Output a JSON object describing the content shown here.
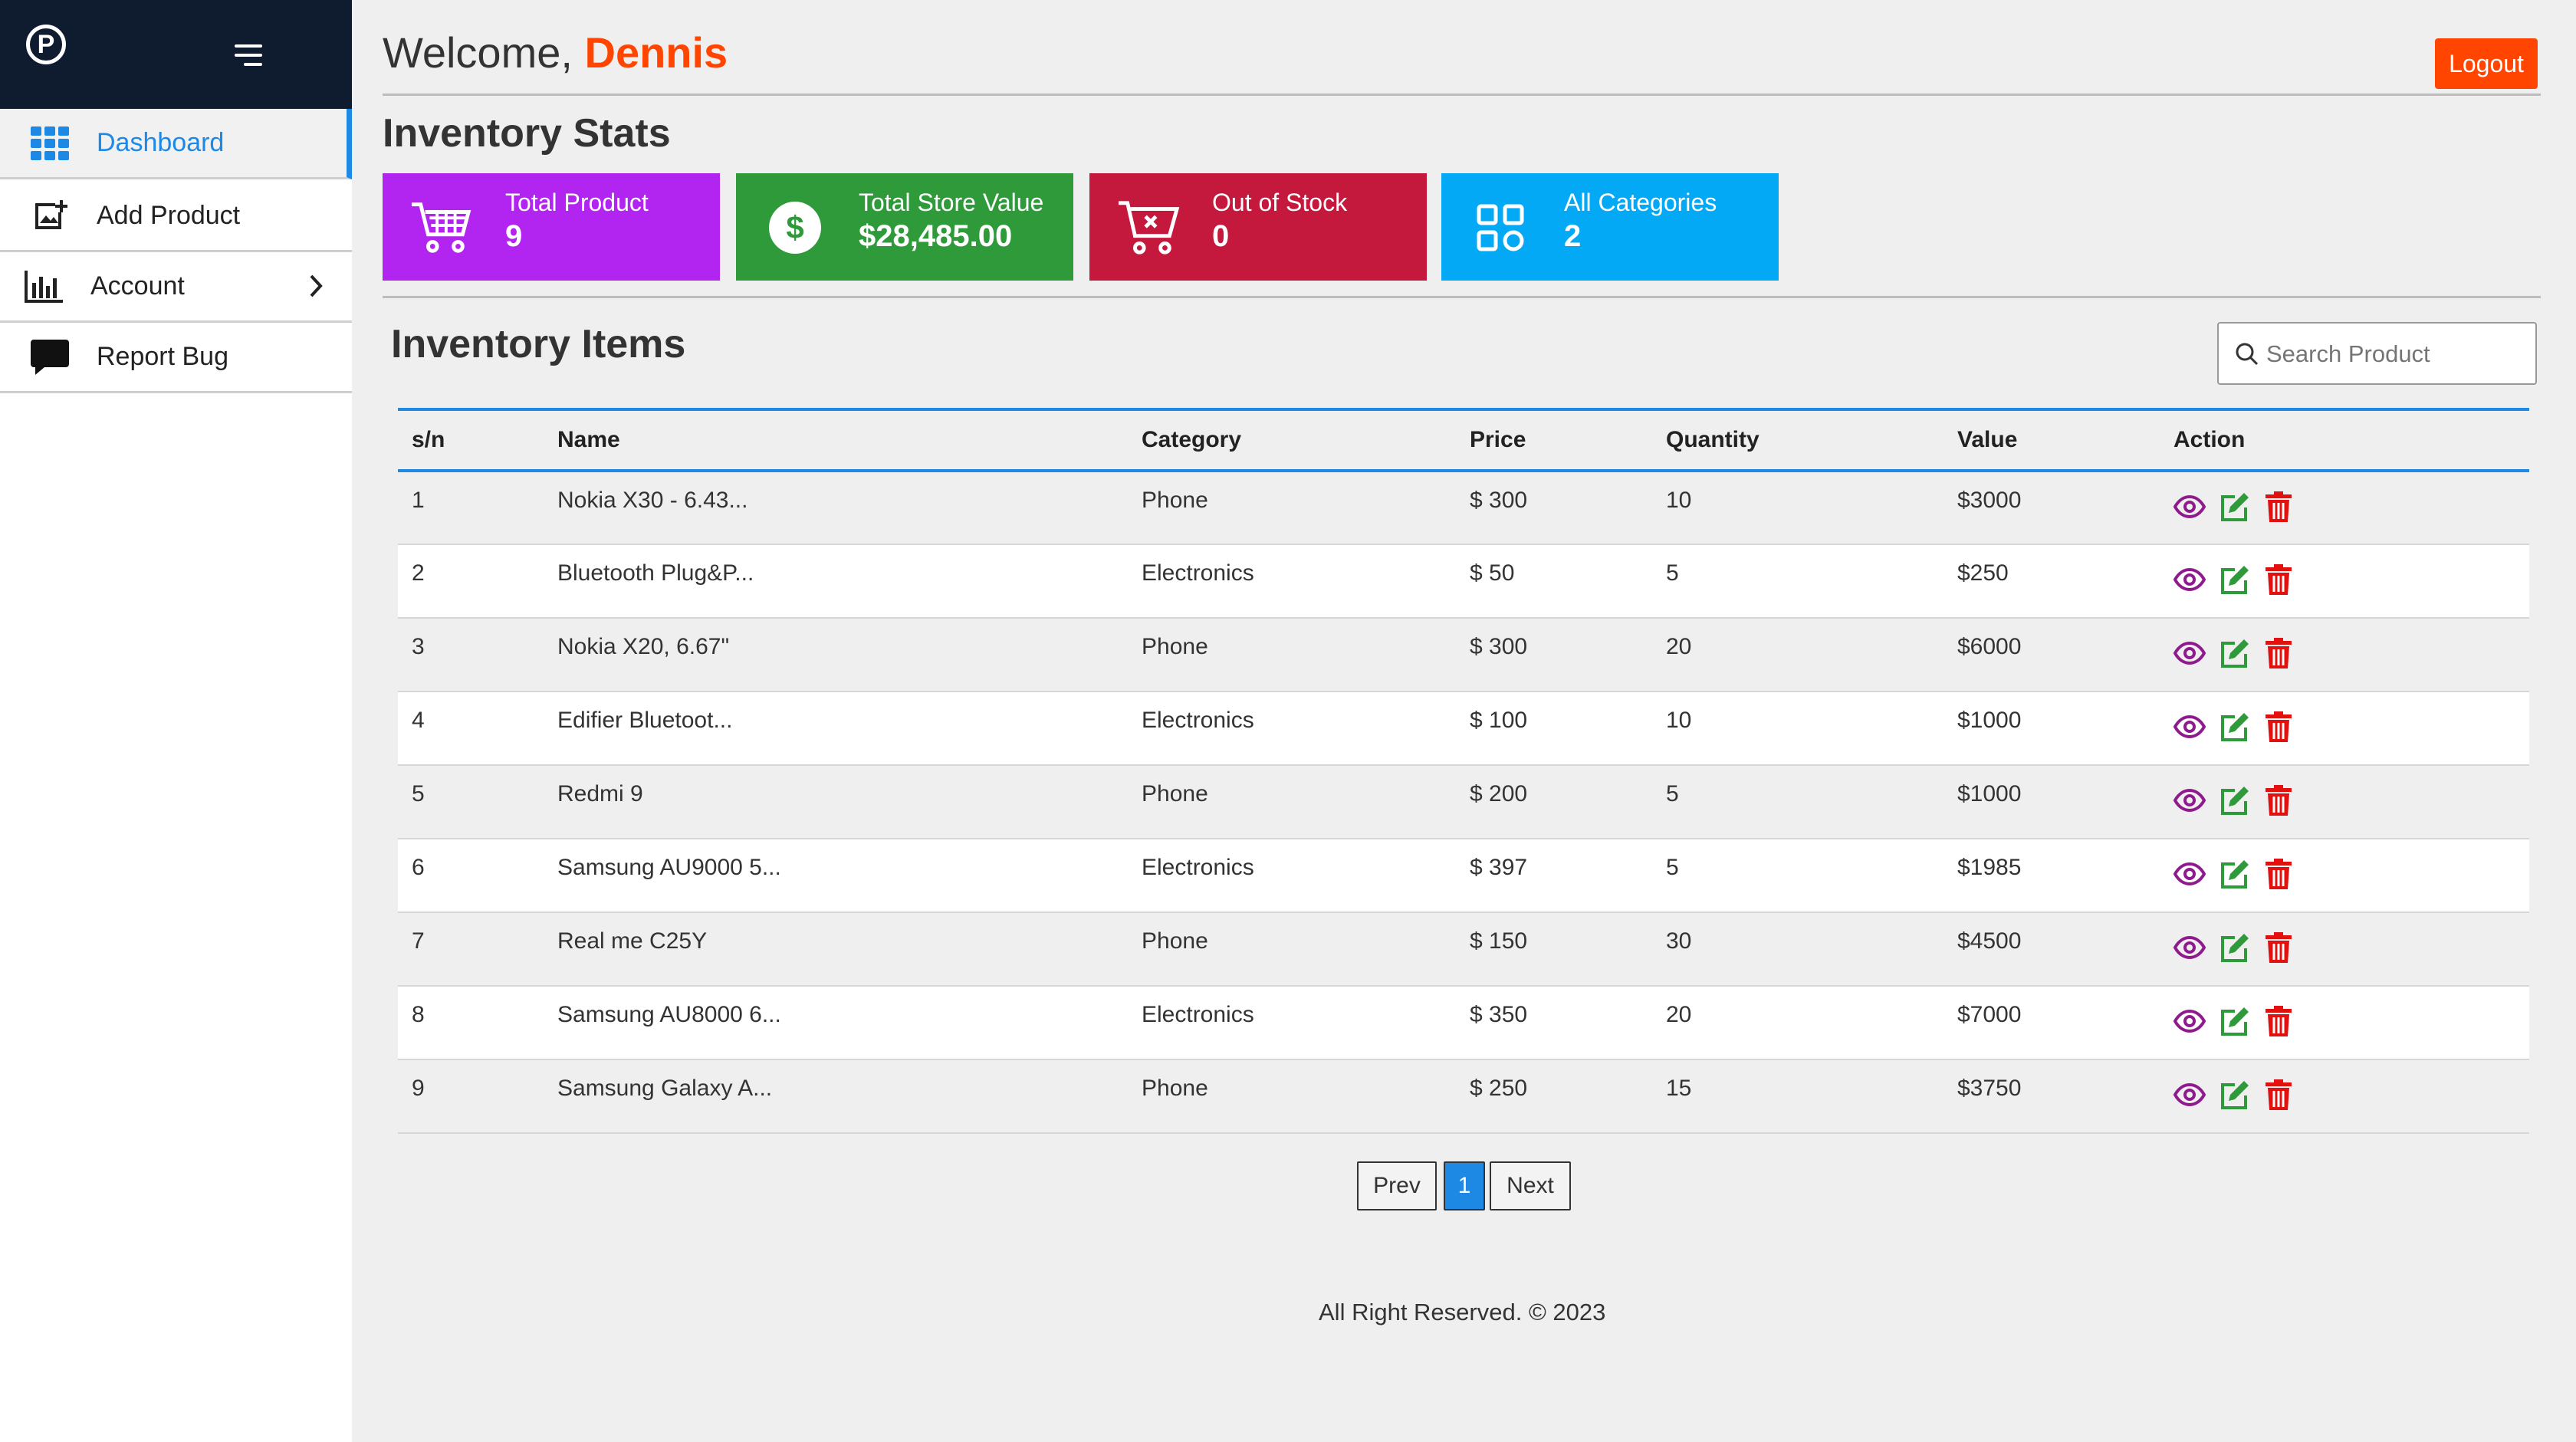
{
  "sidebar": {
    "logo_letter": "P",
    "items": [
      {
        "label": "Dashboard",
        "icon": "grid-icon"
      },
      {
        "label": "Add Product",
        "icon": "add-image-icon"
      },
      {
        "label": "Account",
        "icon": "bar-chart-icon"
      },
      {
        "label": "Report Bug",
        "icon": "chat-bubble-icon"
      }
    ]
  },
  "header": {
    "welcome": "Welcome,",
    "user_name": "Dennis",
    "logout": "Logout"
  },
  "stats": {
    "title": "Inventory Stats",
    "cards": [
      {
        "title": "Total Product",
        "value": "9",
        "color": "#b224ef",
        "icon": "cart-icon"
      },
      {
        "title": "Total Store Value",
        "value": "$28,485.00",
        "color": "#2e9a3a",
        "icon": "dollar-icon"
      },
      {
        "title": "Out of Stock",
        "value": "0",
        "color": "#c4183c",
        "icon": "cart-remove-icon"
      },
      {
        "title": "All Categories",
        "value": "2",
        "color": "#03a9f4",
        "icon": "categories-icon"
      }
    ]
  },
  "inventory": {
    "title": "Inventory Items",
    "search_placeholder": "Search Product",
    "columns": [
      "s/n",
      "Name",
      "Category",
      "Price",
      "Quantity",
      "Value",
      "Action"
    ],
    "rows": [
      [
        "1",
        "Nokia X30 - 6.43...",
        "Phone",
        "$ 300",
        "10",
        "$3000"
      ],
      [
        "2",
        "Bluetooth Plug&P...",
        "Electronics",
        "$ 50",
        "5",
        "$250"
      ],
      [
        "3",
        "Nokia X20, 6.67\"",
        "Phone",
        "$ 300",
        "20",
        "$6000"
      ],
      [
        "4",
        "Edifier Bluetoot...",
        "Electronics",
        "$ 100",
        "10",
        "$1000"
      ],
      [
        "5",
        "Redmi 9",
        "Phone",
        "$ 200",
        "5",
        "$1000"
      ],
      [
        "6",
        "Samsung AU9000 5...",
        "Electronics",
        "$ 397",
        "5",
        "$1985"
      ],
      [
        "7",
        "Real me C25Y",
        "Phone",
        "$ 150",
        "30",
        "$4500"
      ],
      [
        "8",
        "Samsung AU8000 6...",
        "Electronics",
        "$ 350",
        "20",
        "$7000"
      ],
      [
        "9",
        "Samsung Galaxy A...",
        "Phone",
        "$ 250",
        "15",
        "$3750"
      ]
    ]
  },
  "pagination": {
    "prev": "Prev",
    "current": "1",
    "next": "Next"
  },
  "footer": "All Right Reserved. © 2023",
  "colors": {
    "accent": "#1e88e5",
    "logout": "#ff4500",
    "view": "#8e1a8e",
    "edit": "#2e9a3a",
    "delete": "#e31010"
  }
}
